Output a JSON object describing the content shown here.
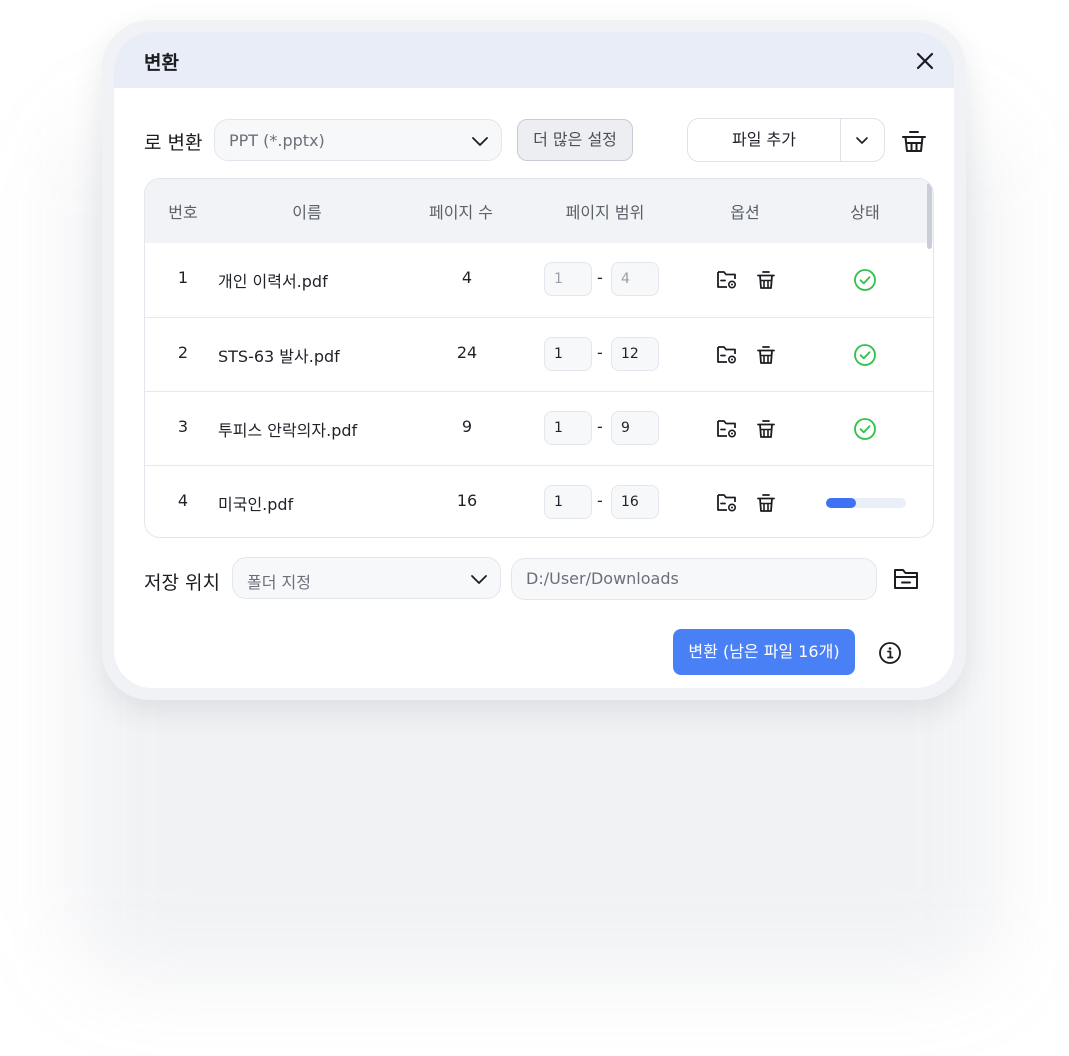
{
  "dialog": {
    "title": "변환"
  },
  "convert_to": {
    "label": "로 변환",
    "format_value": "PPT (*.pptx)",
    "more_settings_label": "더 많은 설정",
    "add_file_label": "파일 추가"
  },
  "table": {
    "headers": [
      "번호",
      "이름",
      "페이지 수",
      "페이지 범위",
      "옵션",
      "상태"
    ],
    "rows": [
      {
        "num": "1",
        "name": "개인 이력서.pdf",
        "pages": "4",
        "range_from": "1",
        "range_sep": "-",
        "range_to": "4",
        "status": "done"
      },
      {
        "num": "2",
        "name": "STS-63 발사.pdf",
        "pages": "24",
        "range_from": "1",
        "range_sep": "-",
        "range_to": "12",
        "status": "done"
      },
      {
        "num": "3",
        "name": "투피스 안락의자.pdf",
        "pages": "9",
        "range_from": "1",
        "range_sep": "-",
        "range_to": "9",
        "status": "done"
      },
      {
        "num": "4",
        "name": "미국인.pdf",
        "pages": "16",
        "range_from": "1",
        "range_sep": "-",
        "range_to": "16",
        "status": "in-progress",
        "progress": 0.38
      }
    ]
  },
  "save": {
    "label": "저장 위치",
    "folder_select_value": "폴더 지정",
    "path_value": "D:/User/Downloads"
  },
  "actions": {
    "convert_label": "변환 (남은 파일 16개)"
  },
  "colors": {
    "accent": "#4a80f5",
    "success": "#2fc24a",
    "progress": "#3e72f2",
    "header_bg": "#e9edf8"
  },
  "icons": {
    "close": "close-icon",
    "format_dropdown": "chevron-down-icon",
    "add_dropdown": "chevron-down-icon",
    "clear_all": "trash-icon",
    "row_folder": "folder-settings-icon",
    "row_delete": "trash-icon",
    "row_status_done": "check-circle-icon",
    "browse_folder": "folder-icon",
    "info": "info-icon"
  }
}
